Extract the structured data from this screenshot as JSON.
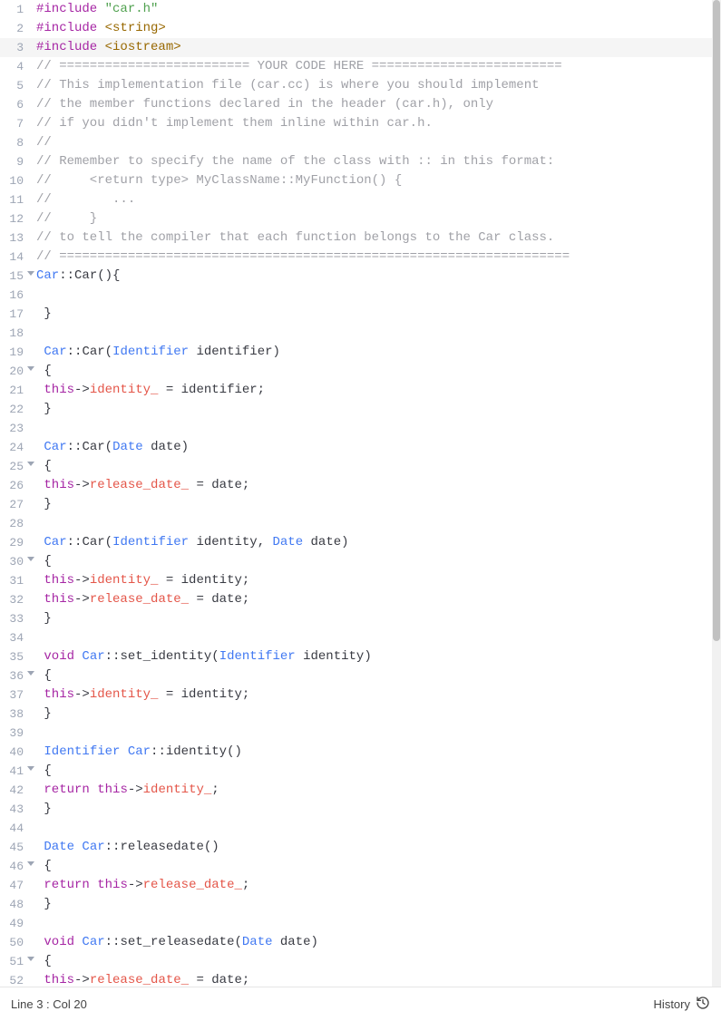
{
  "status": {
    "line": 3,
    "col": 20,
    "history_label": "History"
  },
  "code": {
    "current_line": 3,
    "fold_lines": [
      15,
      20,
      25,
      30,
      36,
      41,
      46,
      51
    ],
    "lines": [
      {
        "n": 1,
        "segs": [
          {
            "t": "#include",
            "c": "tok-keyword"
          },
          {
            "t": " ",
            "c": ""
          },
          {
            "t": "\"car.h\"",
            "c": "tok-string"
          }
        ]
      },
      {
        "n": 2,
        "segs": [
          {
            "t": "#include",
            "c": "tok-keyword"
          },
          {
            "t": " ",
            "c": ""
          },
          {
            "t": "<string>",
            "c": "tok-include"
          }
        ]
      },
      {
        "n": 3,
        "segs": [
          {
            "t": "#include",
            "c": "tok-keyword"
          },
          {
            "t": " ",
            "c": ""
          },
          {
            "t": "<iostream>",
            "c": "tok-include"
          }
        ]
      },
      {
        "n": 4,
        "segs": [
          {
            "t": "// ========================= YOUR CODE HERE =========================",
            "c": "tok-comment"
          }
        ]
      },
      {
        "n": 5,
        "segs": [
          {
            "t": "// This implementation file (car.cc) is where you should implement",
            "c": "tok-comment"
          }
        ]
      },
      {
        "n": 6,
        "segs": [
          {
            "t": "// the member functions declared in the header (car.h), only",
            "c": "tok-comment"
          }
        ]
      },
      {
        "n": 7,
        "segs": [
          {
            "t": "// if you didn't implement them inline within car.h.",
            "c": "tok-comment"
          }
        ]
      },
      {
        "n": 8,
        "segs": [
          {
            "t": "//",
            "c": "tok-comment"
          }
        ]
      },
      {
        "n": 9,
        "segs": [
          {
            "t": "// Remember to specify the name of the class with :: in this format:",
            "c": "tok-comment"
          }
        ]
      },
      {
        "n": 10,
        "segs": [
          {
            "t": "//     <return type> MyClassName::MyFunction() {",
            "c": "tok-comment"
          }
        ]
      },
      {
        "n": 11,
        "segs": [
          {
            "t": "//        ...",
            "c": "tok-comment"
          }
        ]
      },
      {
        "n": 12,
        "segs": [
          {
            "t": "//     }",
            "c": "tok-comment"
          }
        ]
      },
      {
        "n": 13,
        "segs": [
          {
            "t": "// to tell the compiler that each function belongs to the Car class.",
            "c": "tok-comment"
          }
        ]
      },
      {
        "n": 14,
        "segs": [
          {
            "t": "// ===================================================================",
            "c": "tok-comment"
          }
        ]
      },
      {
        "n": 15,
        "segs": [
          {
            "t": "Car",
            "c": "tok-type"
          },
          {
            "t": "::",
            "c": "tok-op"
          },
          {
            "t": "Car",
            "c": "tok-func"
          },
          {
            "t": "(){",
            "c": "tok-op"
          }
        ]
      },
      {
        "n": 16,
        "segs": [
          {
            "t": "",
            "c": ""
          }
        ]
      },
      {
        "n": 17,
        "segs": [
          {
            "t": " }",
            "c": "tok-op"
          }
        ]
      },
      {
        "n": 18,
        "segs": [
          {
            "t": "",
            "c": ""
          }
        ]
      },
      {
        "n": 19,
        "segs": [
          {
            "t": " ",
            "c": ""
          },
          {
            "t": "Car",
            "c": "tok-type"
          },
          {
            "t": "::",
            "c": "tok-op"
          },
          {
            "t": "Car",
            "c": "tok-func"
          },
          {
            "t": "(",
            "c": "tok-op"
          },
          {
            "t": "Identifier",
            "c": "tok-type"
          },
          {
            "t": " identifier)",
            "c": "tok-op"
          }
        ]
      },
      {
        "n": 20,
        "segs": [
          {
            "t": " {",
            "c": "tok-op"
          }
        ]
      },
      {
        "n": 21,
        "segs": [
          {
            "t": " ",
            "c": ""
          },
          {
            "t": "this",
            "c": "tok-keyword2"
          },
          {
            "t": "->",
            "c": "tok-op"
          },
          {
            "t": "identity_",
            "c": "tok-var"
          },
          {
            "t": " = identifier;",
            "c": "tok-op"
          }
        ]
      },
      {
        "n": 22,
        "segs": [
          {
            "t": " }",
            "c": "tok-op"
          }
        ]
      },
      {
        "n": 23,
        "segs": [
          {
            "t": "",
            "c": ""
          }
        ]
      },
      {
        "n": 24,
        "segs": [
          {
            "t": " ",
            "c": ""
          },
          {
            "t": "Car",
            "c": "tok-type"
          },
          {
            "t": "::",
            "c": "tok-op"
          },
          {
            "t": "Car",
            "c": "tok-func"
          },
          {
            "t": "(",
            "c": "tok-op"
          },
          {
            "t": "Date",
            "c": "tok-type"
          },
          {
            "t": " date)",
            "c": "tok-op"
          }
        ]
      },
      {
        "n": 25,
        "segs": [
          {
            "t": " {",
            "c": "tok-op"
          }
        ]
      },
      {
        "n": 26,
        "segs": [
          {
            "t": " ",
            "c": ""
          },
          {
            "t": "this",
            "c": "tok-keyword2"
          },
          {
            "t": "->",
            "c": "tok-op"
          },
          {
            "t": "release_date_",
            "c": "tok-var"
          },
          {
            "t": " = date;",
            "c": "tok-op"
          }
        ]
      },
      {
        "n": 27,
        "segs": [
          {
            "t": " }",
            "c": "tok-op"
          }
        ]
      },
      {
        "n": 28,
        "segs": [
          {
            "t": "",
            "c": ""
          }
        ]
      },
      {
        "n": 29,
        "segs": [
          {
            "t": " ",
            "c": ""
          },
          {
            "t": "Car",
            "c": "tok-type"
          },
          {
            "t": "::",
            "c": "tok-op"
          },
          {
            "t": "Car",
            "c": "tok-func"
          },
          {
            "t": "(",
            "c": "tok-op"
          },
          {
            "t": "Identifier",
            "c": "tok-type"
          },
          {
            "t": " identity, ",
            "c": "tok-op"
          },
          {
            "t": "Date",
            "c": "tok-type"
          },
          {
            "t": " date)",
            "c": "tok-op"
          }
        ]
      },
      {
        "n": 30,
        "segs": [
          {
            "t": " {",
            "c": "tok-op"
          }
        ]
      },
      {
        "n": 31,
        "segs": [
          {
            "t": " ",
            "c": ""
          },
          {
            "t": "this",
            "c": "tok-keyword2"
          },
          {
            "t": "->",
            "c": "tok-op"
          },
          {
            "t": "identity_",
            "c": "tok-var"
          },
          {
            "t": " = identity;",
            "c": "tok-op"
          }
        ]
      },
      {
        "n": 32,
        "segs": [
          {
            "t": " ",
            "c": ""
          },
          {
            "t": "this",
            "c": "tok-keyword2"
          },
          {
            "t": "->",
            "c": "tok-op"
          },
          {
            "t": "release_date_",
            "c": "tok-var"
          },
          {
            "t": " = date;",
            "c": "tok-op"
          }
        ]
      },
      {
        "n": 33,
        "segs": [
          {
            "t": " }",
            "c": "tok-op"
          }
        ]
      },
      {
        "n": 34,
        "segs": [
          {
            "t": "",
            "c": ""
          }
        ]
      },
      {
        "n": 35,
        "segs": [
          {
            "t": " ",
            "c": ""
          },
          {
            "t": "void",
            "c": "tok-keyword2"
          },
          {
            "t": " ",
            "c": ""
          },
          {
            "t": "Car",
            "c": "tok-type"
          },
          {
            "t": "::",
            "c": "tok-op"
          },
          {
            "t": "set_identity",
            "c": "tok-func"
          },
          {
            "t": "(",
            "c": "tok-op"
          },
          {
            "t": "Identifier",
            "c": "tok-type"
          },
          {
            "t": " identity)",
            "c": "tok-op"
          }
        ]
      },
      {
        "n": 36,
        "segs": [
          {
            "t": " {",
            "c": "tok-op"
          }
        ]
      },
      {
        "n": 37,
        "segs": [
          {
            "t": " ",
            "c": ""
          },
          {
            "t": "this",
            "c": "tok-keyword2"
          },
          {
            "t": "->",
            "c": "tok-op"
          },
          {
            "t": "identity_",
            "c": "tok-var"
          },
          {
            "t": " = identity;",
            "c": "tok-op"
          }
        ]
      },
      {
        "n": 38,
        "segs": [
          {
            "t": " }",
            "c": "tok-op"
          }
        ]
      },
      {
        "n": 39,
        "segs": [
          {
            "t": "",
            "c": ""
          }
        ]
      },
      {
        "n": 40,
        "segs": [
          {
            "t": " ",
            "c": ""
          },
          {
            "t": "Identifier",
            "c": "tok-type"
          },
          {
            "t": " ",
            "c": ""
          },
          {
            "t": "Car",
            "c": "tok-type"
          },
          {
            "t": "::",
            "c": "tok-op"
          },
          {
            "t": "identity",
            "c": "tok-func"
          },
          {
            "t": "()",
            "c": "tok-op"
          }
        ]
      },
      {
        "n": 41,
        "segs": [
          {
            "t": " {",
            "c": "tok-op"
          }
        ]
      },
      {
        "n": 42,
        "segs": [
          {
            "t": " ",
            "c": ""
          },
          {
            "t": "return",
            "c": "tok-keyword2"
          },
          {
            "t": " ",
            "c": ""
          },
          {
            "t": "this",
            "c": "tok-keyword2"
          },
          {
            "t": "->",
            "c": "tok-op"
          },
          {
            "t": "identity_",
            "c": "tok-var"
          },
          {
            "t": ";",
            "c": "tok-op"
          }
        ]
      },
      {
        "n": 43,
        "segs": [
          {
            "t": " }",
            "c": "tok-op"
          }
        ]
      },
      {
        "n": 44,
        "segs": [
          {
            "t": "",
            "c": ""
          }
        ]
      },
      {
        "n": 45,
        "segs": [
          {
            "t": " ",
            "c": ""
          },
          {
            "t": "Date",
            "c": "tok-type"
          },
          {
            "t": " ",
            "c": ""
          },
          {
            "t": "Car",
            "c": "tok-type"
          },
          {
            "t": "::",
            "c": "tok-op"
          },
          {
            "t": "releasedate",
            "c": "tok-func"
          },
          {
            "t": "()",
            "c": "tok-op"
          }
        ]
      },
      {
        "n": 46,
        "segs": [
          {
            "t": " {",
            "c": "tok-op"
          }
        ]
      },
      {
        "n": 47,
        "segs": [
          {
            "t": " ",
            "c": ""
          },
          {
            "t": "return",
            "c": "tok-keyword2"
          },
          {
            "t": " ",
            "c": ""
          },
          {
            "t": "this",
            "c": "tok-keyword2"
          },
          {
            "t": "->",
            "c": "tok-op"
          },
          {
            "t": "release_date_",
            "c": "tok-var"
          },
          {
            "t": ";",
            "c": "tok-op"
          }
        ]
      },
      {
        "n": 48,
        "segs": [
          {
            "t": " }",
            "c": "tok-op"
          }
        ]
      },
      {
        "n": 49,
        "segs": [
          {
            "t": "",
            "c": ""
          }
        ]
      },
      {
        "n": 50,
        "segs": [
          {
            "t": " ",
            "c": ""
          },
          {
            "t": "void",
            "c": "tok-keyword2"
          },
          {
            "t": " ",
            "c": ""
          },
          {
            "t": "Car",
            "c": "tok-type"
          },
          {
            "t": "::",
            "c": "tok-op"
          },
          {
            "t": "set_releasedate",
            "c": "tok-func"
          },
          {
            "t": "(",
            "c": "tok-op"
          },
          {
            "t": "Date",
            "c": "tok-type"
          },
          {
            "t": " date)",
            "c": "tok-op"
          }
        ]
      },
      {
        "n": 51,
        "segs": [
          {
            "t": " {",
            "c": "tok-op"
          }
        ]
      },
      {
        "n": 52,
        "segs": [
          {
            "t": " ",
            "c": ""
          },
          {
            "t": "this",
            "c": "tok-keyword2"
          },
          {
            "t": "->",
            "c": "tok-op"
          },
          {
            "t": "release_date_",
            "c": "tok-var"
          },
          {
            "t": " = date;",
            "c": "tok-op"
          }
        ]
      }
    ]
  }
}
